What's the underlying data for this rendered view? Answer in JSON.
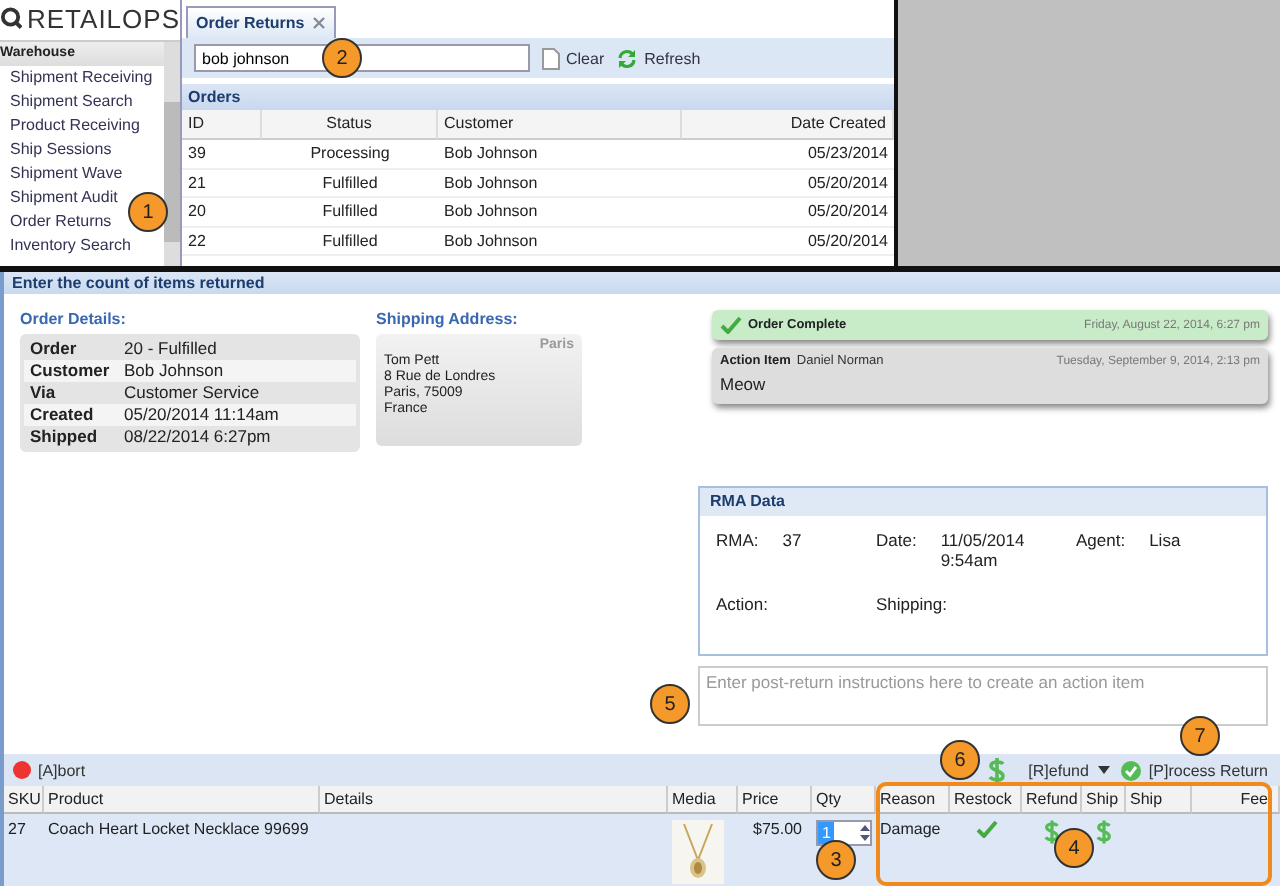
{
  "logo": {
    "text": "RETAILOPS"
  },
  "sidebar": {
    "section": "Warehouse",
    "items": [
      "Shipment Receiving",
      "Shipment Search",
      "Product Receiving",
      "Ship Sessions",
      "Shipment Wave",
      "Shipment Audit",
      "Order Returns",
      "Inventory Search"
    ]
  },
  "tab": {
    "label": "Order Returns"
  },
  "toolbar": {
    "search": "bob johnson",
    "clear": "Clear",
    "refresh": "Refresh"
  },
  "orders": {
    "title": "Orders",
    "columns": [
      "ID",
      "Status",
      "Customer",
      "Date Created"
    ],
    "rows": [
      [
        "39",
        "Processing",
        "Bob Johnson",
        "05/23/2014"
      ],
      [
        "21",
        "Fulfilled",
        "Bob Johnson",
        "05/20/2014"
      ],
      [
        "20",
        "Fulfilled",
        "Bob Johnson",
        "05/20/2014"
      ],
      [
        "22",
        "Fulfilled",
        "Bob Johnson",
        "05/20/2014"
      ]
    ]
  },
  "return_panel": {
    "title": "Enter the count of items returned",
    "order_details": {
      "label": "Order Details:",
      "fields": [
        {
          "key": "Order",
          "value": "20 - Fulfilled"
        },
        {
          "key": "Customer",
          "value": "Bob Johnson"
        },
        {
          "key": "Via",
          "value": "Customer Service"
        },
        {
          "key": "Created",
          "value": "05/20/2014 11:14am"
        },
        {
          "key": "Shipped",
          "value": "08/22/2014 6:27pm"
        }
      ]
    },
    "shipping": {
      "label": "Shipping Address:",
      "tag": "Paris",
      "lines": [
        "Tom Pett",
        "8 Rue de Londres",
        "Paris, 75009",
        "France"
      ]
    },
    "events": [
      {
        "kind": "complete",
        "title": "Order Complete",
        "date": "Friday, August 22, 2014, 6:27 pm"
      },
      {
        "kind": "action",
        "title": "Action Item",
        "author": "Daniel Norman",
        "date": "Tuesday, September 9, 2014, 2:13 pm",
        "body": "Meow"
      }
    ],
    "rma": {
      "title": "RMA Data",
      "fields": [
        {
          "label": "RMA:",
          "value": "37"
        },
        {
          "label": "Date:",
          "value": "11/05/2014 9:54am"
        },
        {
          "label": "Agent:",
          "value": "Lisa"
        },
        {
          "label": "Action:"
        },
        {
          "label": "Shipping:"
        }
      ]
    },
    "instructions": {
      "placeholder": "Enter post-return instructions here to create an action item"
    },
    "actions": {
      "abort": "[A]bort",
      "refund": "[R]efund",
      "process": "[P]rocess Return"
    },
    "items": {
      "columns": [
        "SKU",
        "Product",
        "Details",
        "Media",
        "Price",
        "Qty",
        "Reason",
        "Restock",
        "Refund",
        "Ship",
        "Ship",
        "Fee"
      ],
      "rows": [
        {
          "sku": "27",
          "product": "Coach Heart Locket Necklace 99699",
          "price": "$75.00",
          "qty": "1",
          "reason": "Damage",
          "restock": true,
          "refund": true,
          "ship": true
        }
      ]
    }
  },
  "callouts": [
    "1",
    "2",
    "3",
    "4",
    "5",
    "6",
    "7"
  ]
}
